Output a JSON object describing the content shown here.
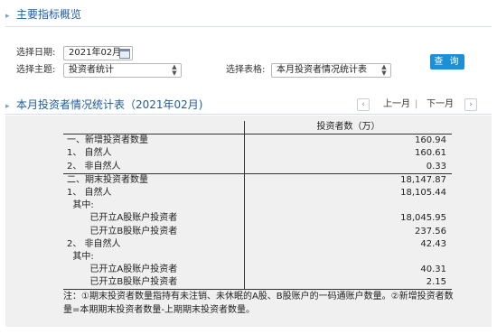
{
  "section1": {
    "title": "主要指标概览"
  },
  "form": {
    "date_label": "选择日期:",
    "date_value": "2021年02月",
    "topic_label": "选择主题:",
    "topic_value": "投资者统计",
    "table_label": "选择表格:",
    "table_value": "本月投资者情况统计表",
    "query_label": "查 询"
  },
  "section2": {
    "title": "本月投资者情况统计表（2021年02月)"
  },
  "pager": {
    "prev_label": "上一月",
    "sep": "|",
    "next_label": "下一月",
    "prev_arrow": "‹",
    "next_arrow": "›"
  },
  "table": {
    "header": [
      "",
      "投资者数（万）"
    ],
    "rows": [
      {
        "label": "一、新增投资者数量",
        "value": "160.94"
      },
      {
        "label": "1、  自然人",
        "value": "160.61"
      },
      {
        "label": "2、  非自然人",
        "value": "0.33"
      },
      {
        "label": "二、期末投资者数量",
        "value": "18,147.87"
      },
      {
        "label": "1、  自然人",
        "value": "18,105.44"
      },
      {
        "label": "  其中:",
        "value": ""
      },
      {
        "label": "        已开立A股账户投资者",
        "value": "18,045.95"
      },
      {
        "label": "        已开立B股账户投资者",
        "value": "237.56"
      },
      {
        "label": "2、  非自然人",
        "value": "42.43"
      },
      {
        "label": "  其中:",
        "value": ""
      },
      {
        "label": "        已开立A股账户投资者",
        "value": "40.31"
      },
      {
        "label": "        已开立B股账户投资者",
        "value": "2.15"
      }
    ]
  },
  "note": "注：①期末投资者数量指持有未注销、未休眠的A股、B股账户的一码通账户数量。②新增投资者数量=本期期末投资者数量-上期期末投资者数量。"
}
